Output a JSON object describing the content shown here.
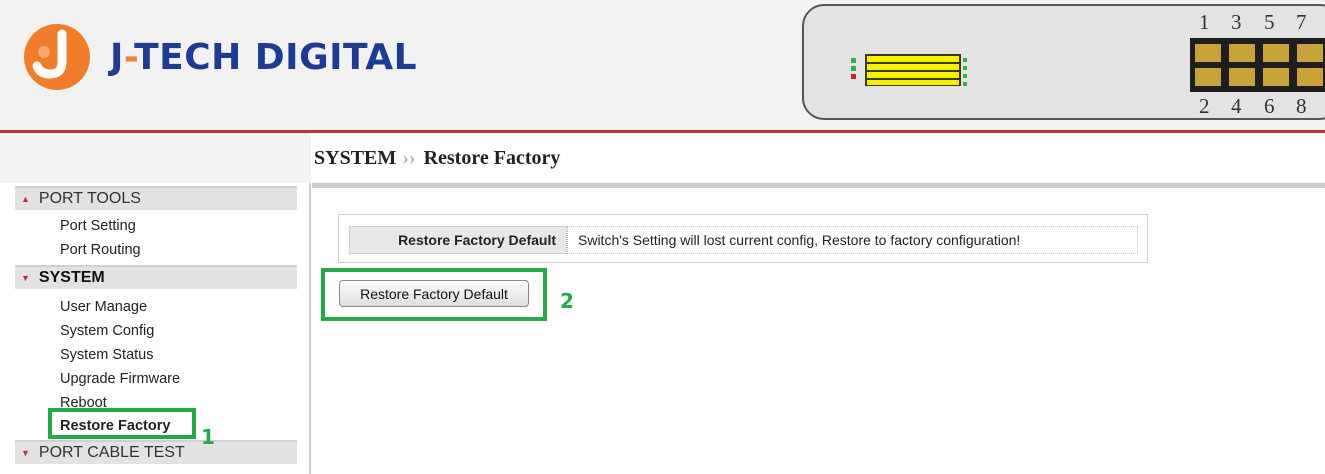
{
  "header": {
    "brand_prefix": "J",
    "brand_dash": "-",
    "brand_rest": "TECH DIGITAL",
    "port_numbers_top": [
      "1",
      "3",
      "5",
      "7"
    ],
    "port_numbers_bottom": [
      "2",
      "4",
      "6",
      "8"
    ],
    "colors": {
      "brand_blue": "#1f3a93",
      "brand_orange": "#f07d2a",
      "header_rule": "#c0332e"
    }
  },
  "breadcrumb": {
    "section": "SYSTEM",
    "separator": "››",
    "page": "Restore Factory"
  },
  "sidebar": {
    "sections": [
      {
        "label": "PORT TOOLS",
        "arrow": "▲",
        "items": [
          "Port Setting",
          "Port Routing"
        ]
      },
      {
        "label": "SYSTEM",
        "arrow": "▼",
        "items": [
          "User Manage",
          "System Config",
          "System Status",
          "Upgrade Firmware",
          "Reboot",
          "Restore Factory"
        ]
      },
      {
        "label": "PORT CABLE TEST",
        "arrow": "▼",
        "items": []
      }
    ],
    "active_item": "Restore Factory"
  },
  "main": {
    "row_label": "Restore Factory Default",
    "row_value": "Switch's Setting will lost current config, Restore to factory configuration!",
    "button_label": "Restore Factory Default"
  },
  "annotations": {
    "step1": "1",
    "step2": "2",
    "color": "#23a84a"
  }
}
